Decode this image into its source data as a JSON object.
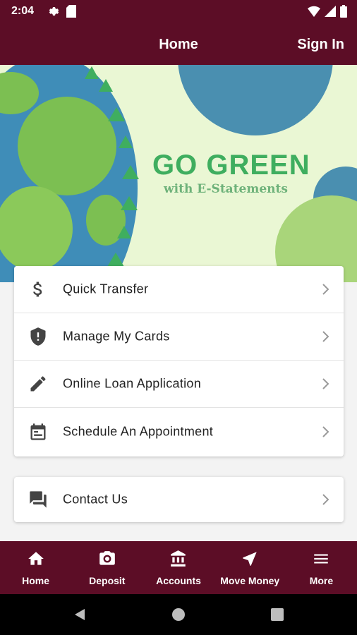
{
  "status_bar": {
    "time": "2:04"
  },
  "app_bar": {
    "title": "Home",
    "sign_in": "Sign In"
  },
  "banner": {
    "headline": "GO GREEN",
    "subline": "with E-Statements"
  },
  "menu": [
    {
      "label": "Quick Transfer",
      "icon": "dollar-icon"
    },
    {
      "label": "Manage My Cards",
      "icon": "shield-icon"
    },
    {
      "label": "Online Loan Application",
      "icon": "pencil-icon"
    },
    {
      "label": "Schedule An Appointment",
      "icon": "calendar-icon"
    }
  ],
  "contact": {
    "label": "Contact Us",
    "icon": "chat-icon"
  },
  "bottom_nav": [
    {
      "label": "Home",
      "icon": "home-icon"
    },
    {
      "label": "Deposit",
      "icon": "camera-icon"
    },
    {
      "label": "Accounts",
      "icon": "bank-icon"
    },
    {
      "label": "Move Money",
      "icon": "navigation-icon"
    },
    {
      "label": "More",
      "icon": "menu-icon"
    }
  ],
  "colors": {
    "brand": "#5c0d26",
    "banner_bg": "#eaf7d4",
    "headline_green": "#3fae5f"
  }
}
